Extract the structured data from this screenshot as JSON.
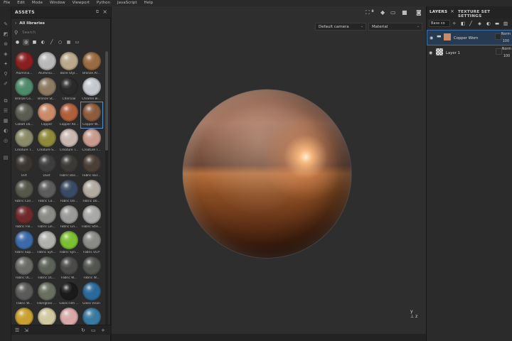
{
  "menu": [
    "File",
    "Edit",
    "Mode",
    "Window",
    "Viewport",
    "Python",
    "JavaScript",
    "Help"
  ],
  "assets": {
    "title": "ASSETS",
    "library": "All libraries",
    "search_placeholder": "Search",
    "items": [
      {
        "label": "Aluminiu...",
        "color": "#8a1f1f"
      },
      {
        "label": "Aluminiu...",
        "color": "#b9b9b9"
      },
      {
        "label": "Bone Styl...",
        "color": "#b9a88a"
      },
      {
        "label": "Bronze Ar...",
        "color": "#9a6a40"
      },
      {
        "label": "Bronze Co...",
        "color": "#4f8a6c"
      },
      {
        "label": "Bronze St...",
        "color": "#8c7a62"
      },
      {
        "label": "Charcoal",
        "color": "#2a2a2a"
      },
      {
        "label": "Chrome Bl...",
        "color": "#c4c8cc"
      },
      {
        "label": "Cobalt Da...",
        "color": "#5a5c52"
      },
      {
        "label": "Copper",
        "color": "#c98a6a"
      },
      {
        "label": "Copper Re...",
        "color": "#b05e3c"
      },
      {
        "label": "Copper W...",
        "color": "#8d5c3e"
      },
      {
        "label": "Creature T...",
        "color": "#8a8a6a"
      },
      {
        "label": "Creature S...",
        "color": "#8e8a3a"
      },
      {
        "label": "Creature T...",
        "color": "#c8b8b0"
      },
      {
        "label": "Creature T...",
        "color": "#c89a8e"
      },
      {
        "label": "Dirt",
        "color": "#3a3530"
      },
      {
        "label": "Dust",
        "color": "#3d3d3d"
      },
      {
        "label": "Fabric Bas...",
        "color": "#3c3a36"
      },
      {
        "label": "Fabric Bur...",
        "color": "#4a3f36"
      },
      {
        "label": "Fabric Can...",
        "color": "#54574a"
      },
      {
        "label": "Fabric Co...",
        "color": "#5c5c5c"
      },
      {
        "label": "Fabric De...",
        "color": "#3a4a64"
      },
      {
        "label": "Fabric Do...",
        "color": "#b0aaa0"
      },
      {
        "label": "Fabric Fle...",
        "color": "#6e2a2a"
      },
      {
        "label": "Fabric Lin...",
        "color": "#8a8a86"
      },
      {
        "label": "Fabric Lin...",
        "color": "#9a9a98"
      },
      {
        "label": "Fabric Stre...",
        "color": "#a8a8a6"
      },
      {
        "label": "Fabric Sup...",
        "color": "#3a6aa8"
      },
      {
        "label": "Fabric Syn...",
        "color": "#b0b0ac"
      },
      {
        "label": "Fabric Syn...",
        "color": "#7ac030"
      },
      {
        "label": "Fabric UCP",
        "color": "#8a8a86"
      },
      {
        "label": "Fabric UC...",
        "color": "#6a6a66"
      },
      {
        "label": "Fabric UC...",
        "color": "#5c6258"
      },
      {
        "label": "Fabric W...",
        "color": "#4a4a48"
      },
      {
        "label": "Fabric W...",
        "color": "#525450"
      },
      {
        "label": "Fabric W...",
        "color": "#5a5a58"
      },
      {
        "label": "Fiberglass ...",
        "color": "#6a7060"
      },
      {
        "label": "Glass Film ...",
        "color": "#1a1a1a"
      },
      {
        "label": "Glass Vison",
        "color": "#2a6a9a"
      },
      {
        "label": "",
        "color": "#c9a030"
      },
      {
        "label": "",
        "color": "#d0c8a0"
      },
      {
        "label": "",
        "color": "#d8a8a8"
      },
      {
        "label": "",
        "color": "#3a7aa0"
      }
    ]
  },
  "viewport": {
    "camera": "Default camera",
    "mode": "Material"
  },
  "layers": {
    "tab_layers": "LAYERS",
    "tab_texture_set": "TEXTURE SET SETTINGS",
    "channel": "Base co",
    "rows": [
      {
        "name": "Copper Worn",
        "blend": "Norm",
        "opacity": "100",
        "thumb": "#c98a6a",
        "selected": true
      },
      {
        "name": "Layer 1",
        "blend": "Norm",
        "opacity": "100",
        "thumb": "#d8d8d8",
        "selected": false
      }
    ]
  }
}
